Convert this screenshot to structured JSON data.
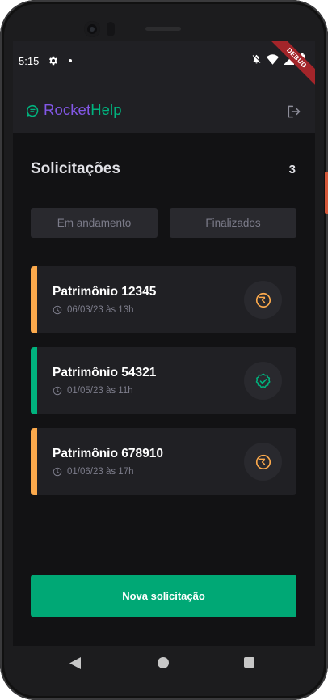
{
  "status_bar": {
    "time": "5:15",
    "icons": [
      "gear-icon",
      "dot-icon",
      "mute-icon",
      "wifi-icon",
      "signal-icon",
      "battery-icon"
    ]
  },
  "debug_banner": "DEBUG",
  "header": {
    "brand_part1": "Rocket",
    "brand_part2": "Help",
    "brand_colors": {
      "rocket": "#8257e5",
      "help": "#00b37e"
    },
    "logout_icon": "sign-out-icon"
  },
  "main": {
    "title": "Solicitações",
    "count": "3",
    "filters": [
      {
        "label": "Em andamento"
      },
      {
        "label": "Finalizados"
      }
    ],
    "orders": [
      {
        "patrimony": "Patrimônio 12345",
        "date": "06/03/23 às 13h",
        "status": "open",
        "color": "#fba94c",
        "icon": "hourglass-icon"
      },
      {
        "patrimony": "Patrimônio 54321",
        "date": "01/05/23 às 11h",
        "status": "closed",
        "color": "#00b37e",
        "icon": "check-circle-icon"
      },
      {
        "patrimony": "Patrimônio 678910",
        "date": "01/06/23 às 17h",
        "status": "open",
        "color": "#fba94c",
        "icon": "hourglass-icon"
      }
    ],
    "new_button": "Nova solicitação"
  },
  "colors": {
    "background": "#121214",
    "card": "#202024",
    "accent_green": "#00a875",
    "accent_orange": "#fba94c"
  }
}
